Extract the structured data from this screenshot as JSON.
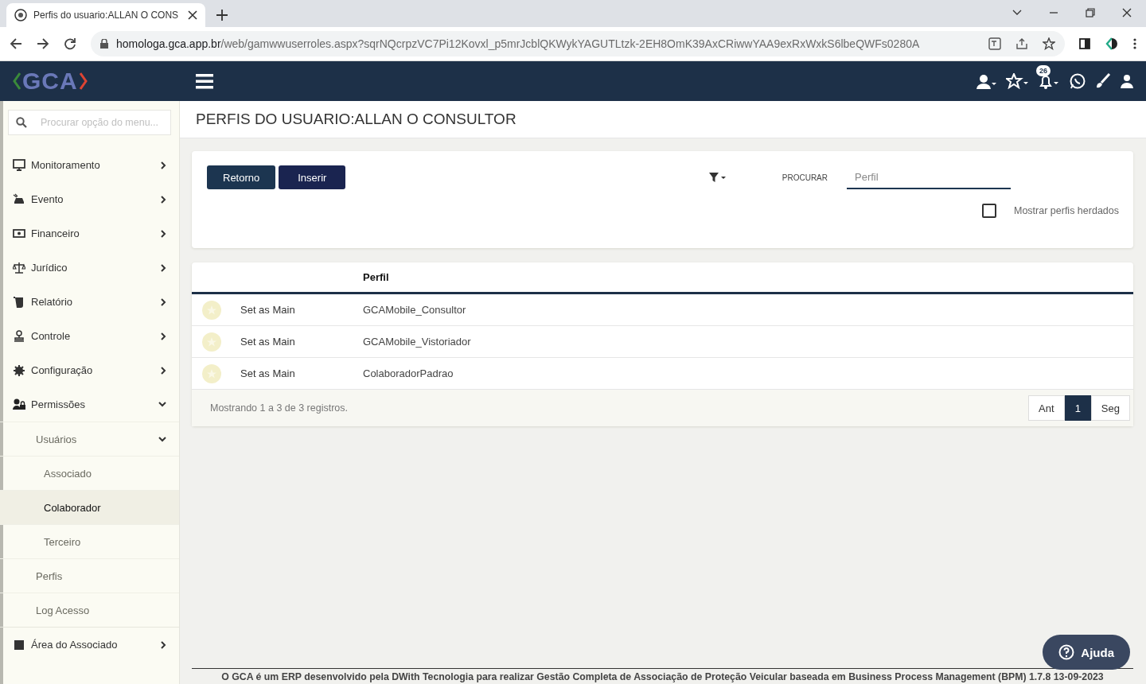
{
  "browser": {
    "tab_title": "Perfis do usuario:ALLAN O CONS",
    "url_host": "homologa.gca.app.br",
    "url_path": "/web/gamwwuserroles.aspx?sqrNQcrpzVC7Pi12Kovxl_p5mrJcblQKWykYAGUTLtzk-2EH8OmK39AxCRiwwYAA9exRxWxkS6lbeQWFs0280A"
  },
  "header": {
    "logo": "GCA",
    "notification_count": "26"
  },
  "sidebar": {
    "search": {
      "placeholder": "Procurar opção do menu..."
    },
    "items": [
      {
        "label": "Monitoramento",
        "expanded": false
      },
      {
        "label": "Evento",
        "expanded": false
      },
      {
        "label": "Financeiro",
        "expanded": false
      },
      {
        "label": "Jurídico",
        "expanded": false
      },
      {
        "label": "Relatório",
        "expanded": false
      },
      {
        "label": "Controle",
        "expanded": false
      },
      {
        "label": "Configuração",
        "expanded": false
      },
      {
        "label": "Permissões",
        "expanded": true,
        "children": [
          {
            "label": "Usuários",
            "expanded": true,
            "children": [
              {
                "label": "Associado",
                "selected": false
              },
              {
                "label": "Colaborador",
                "selected": true
              },
              {
                "label": "Terceiro",
                "selected": false
              }
            ]
          },
          {
            "label": "Perfis"
          },
          {
            "label": "Log Acesso"
          }
        ]
      },
      {
        "label": "Área do Associado",
        "expanded": false
      }
    ]
  },
  "page_title": "PERFIS DO USUARIO:ALLAN O CONSULTOR",
  "toolbar": {
    "buttons": [
      "Retorno",
      "Inserir"
    ],
    "search_label": "PROCURAR",
    "search_field": {
      "placeholder": "Perfil"
    },
    "checkbox": {
      "label": "Mostrar perfis herdados",
      "checked": false
    }
  },
  "table": {
    "columns": [
      "Perfil"
    ],
    "rows": [
      {
        "action": "Set as Main",
        "perfil": "GCAMobile_Consultor"
      },
      {
        "action": "Set as Main",
        "perfil": "GCAMobile_Vistoriador"
      },
      {
        "action": "Set as Main",
        "perfil": "ColaboradorPadrao"
      }
    ]
  },
  "pagination": {
    "info": "Mostrando 1 a 3 de 3 registros.",
    "prev": "Ant",
    "pages": [
      {
        "label": "1",
        "selected": true
      }
    ],
    "next": "Seg"
  },
  "help_button": "Ajuda",
  "footer": "O GCA é um ERP desenvolvido pela DWith Tecnologia para realizar Gestão Completa de Associação de Proteção Veicular baseada em Business Process Management (BPM) 1.7.8 13-09-2023"
}
